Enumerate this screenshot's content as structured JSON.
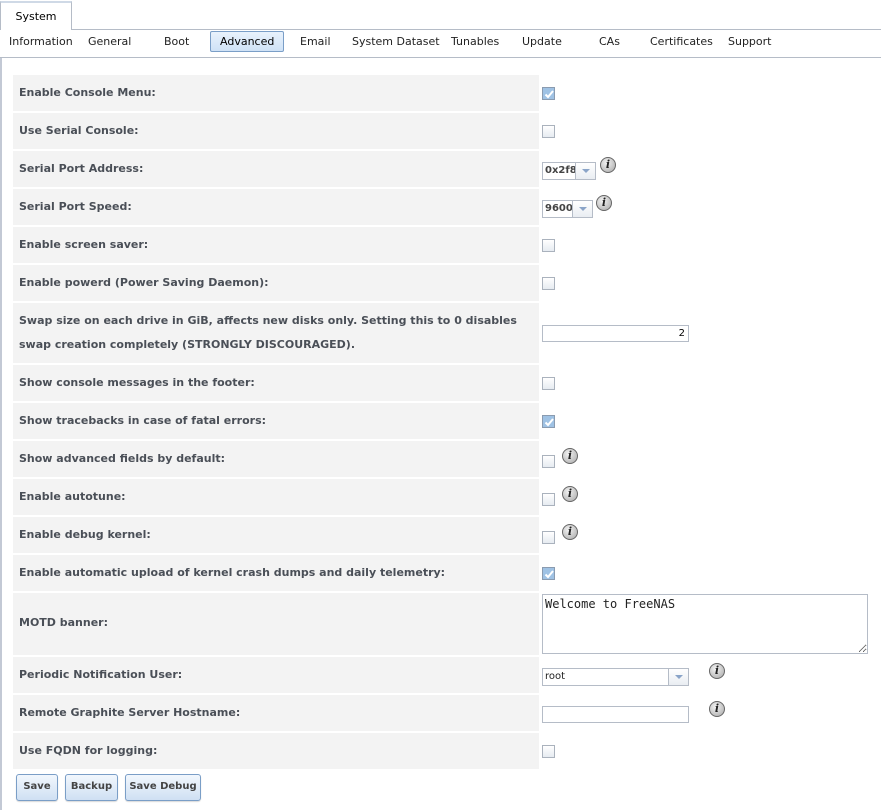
{
  "top_tab": {
    "label": "System"
  },
  "subtabs": [
    {
      "label": "Information",
      "active": false
    },
    {
      "label": "General",
      "active": false
    },
    {
      "label": "Boot",
      "active": false
    },
    {
      "label": "Advanced",
      "active": true
    },
    {
      "label": "Email",
      "active": false
    },
    {
      "label": "System Dataset",
      "active": false
    },
    {
      "label": "Tunables",
      "active": false
    },
    {
      "label": "Update",
      "active": false
    },
    {
      "label": "CAs",
      "active": false
    },
    {
      "label": "Certificates",
      "active": false
    },
    {
      "label": "Support",
      "active": false
    }
  ],
  "form": {
    "enable_console_menu": {
      "label": "Enable Console Menu:",
      "checked": true
    },
    "use_serial_console": {
      "label": "Use Serial Console:",
      "checked": false
    },
    "serial_port_address": {
      "label": "Serial Port Address:",
      "value": "0x2f8",
      "info_icon": "info-icon"
    },
    "serial_port_speed": {
      "label": "Serial Port Speed:",
      "value": "9600",
      "info_icon": "info-icon"
    },
    "enable_screen_saver": {
      "label": "Enable screen saver:",
      "checked": false
    },
    "enable_powerd": {
      "label": "Enable powerd (Power Saving Daemon):",
      "checked": false
    },
    "swap_size": {
      "label": "Swap size on each drive in GiB, affects new disks only. Setting this to 0 disables swap creation completely (STRONGLY DISCOURAGED).",
      "value": "2"
    },
    "show_console_messages": {
      "label": "Show console messages in the footer:",
      "checked": false
    },
    "show_tracebacks": {
      "label": "Show tracebacks in case of fatal errors:",
      "checked": true
    },
    "show_advanced_fields": {
      "label": "Show advanced fields by default:",
      "checked": false,
      "info_icon": "info-icon"
    },
    "enable_autotune": {
      "label": "Enable autotune:",
      "checked": false,
      "info_icon": "info-icon"
    },
    "enable_debug_kernel": {
      "label": "Enable debug kernel:",
      "checked": false,
      "info_icon": "info-icon"
    },
    "enable_crash_upload": {
      "label": "Enable automatic upload of kernel crash dumps and daily telemetry:",
      "checked": true
    },
    "motd_banner": {
      "label": "MOTD banner:",
      "value": "Welcome to FreeNAS"
    },
    "periodic_notification_user": {
      "label": "Periodic Notification User:",
      "value": "root",
      "info_icon": "info-icon"
    },
    "remote_graphite_hostname": {
      "label": "Remote Graphite Server Hostname:",
      "value": "",
      "info_icon": "info-icon"
    },
    "use_fqdn_logging": {
      "label": "Use FQDN for logging:",
      "checked": false
    }
  },
  "buttons": {
    "save": "Save",
    "backup": "Backup",
    "save_debug": "Save Debug"
  }
}
